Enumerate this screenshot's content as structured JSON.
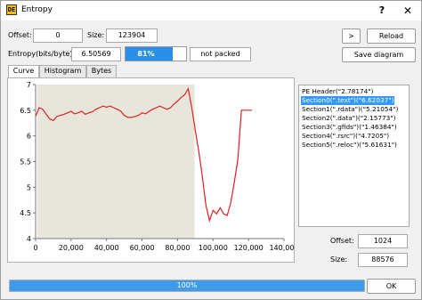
{
  "window": {
    "title": "Entropy",
    "icon": "app-logo-icon",
    "help_label": "?",
    "close_label": "✕"
  },
  "info": {
    "offset_label": "Offset:",
    "offset_value": "0",
    "size_label": "Size:",
    "size_value": "123904",
    "entropy_label": "Entropy(bits/byte):",
    "entropy_value": "6.50569",
    "entropy_percent_text": "81%",
    "entropy_fraction": 0.81,
    "packed_status": "not packed"
  },
  "buttons": {
    "toggle": ">",
    "reload": "Reload",
    "save": "Save diagram",
    "ok": "OK"
  },
  "tabs": [
    {
      "label": "Curve"
    },
    {
      "label": "Histogram"
    },
    {
      "label": "Bytes"
    }
  ],
  "sections": {
    "items": [
      "PE Header(\"2.78174\")",
      "Section0(\".text\")(\"6.62037\")",
      "Section1(\".rdata\")(\"5.21054\")",
      "Section2(\".data\")(\"2.15773\")",
      "Section3(\".gfids\")(\"1.46384\")",
      "Section4(\".rsrc\")(\"4.7205\")",
      "Section5(\".reloc\")(\"5.61631\")"
    ],
    "selected_index": 1
  },
  "selection": {
    "offset_label": "Offset:",
    "offset_value": "1024",
    "size_label": "Size:",
    "size_value": "88576"
  },
  "progress": {
    "text": "100%",
    "fraction": 1.0
  },
  "colors": {
    "curve": "#e02020",
    "highlight": "#e8e6da",
    "accent": "#3399ff",
    "entropy_fill": "#2a8fe8"
  },
  "chart_data": {
    "type": "line",
    "xlim": [
      0,
      140000
    ],
    "ylim": [
      4,
      7
    ],
    "x_ticks": [
      "0",
      "20,000",
      "40,000",
      "60,000",
      "80,000",
      "100,000",
      "120,000",
      "140,000"
    ],
    "y_ticks": [
      "4",
      "4.5",
      "5",
      "5.5",
      "6",
      "6.5",
      "7"
    ],
    "highlight_range": [
      1024,
      89600
    ],
    "series": [
      {
        "x": [
          0,
          2000,
          4000,
          6000,
          8000,
          10000,
          12000,
          14000,
          16000,
          18000,
          20000,
          22000,
          24000,
          26000,
          28000,
          30000,
          32000,
          34000,
          36000,
          38000,
          40000,
          42000,
          44000,
          46000,
          48000,
          50000,
          52000,
          54000,
          56000,
          58000,
          60000,
          62000,
          64000,
          66000,
          68000,
          70000,
          72000,
          74000,
          76000,
          78000,
          80000,
          82000,
          84000,
          86000,
          88000,
          90000,
          92000,
          94000,
          96000,
          98000,
          100000,
          102000,
          104000,
          106000,
          108000,
          110000,
          112000,
          114000,
          116000,
          118000,
          120000,
          122000
        ],
        "y": [
          6.38,
          6.55,
          6.52,
          6.42,
          6.33,
          6.3,
          6.38,
          6.4,
          6.42,
          6.45,
          6.48,
          6.43,
          6.45,
          6.48,
          6.42,
          6.45,
          6.47,
          6.52,
          6.55,
          6.58,
          6.56,
          6.58,
          6.55,
          6.52,
          6.48,
          6.4,
          6.36,
          6.36,
          6.38,
          6.4,
          6.45,
          6.43,
          6.48,
          6.52,
          6.55,
          6.58,
          6.55,
          6.52,
          6.55,
          6.62,
          6.68,
          6.75,
          6.8,
          6.92,
          6.55,
          6.1,
          5.7,
          5.2,
          4.65,
          4.35,
          4.55,
          4.48,
          4.6,
          4.48,
          4.45,
          4.7,
          5.1,
          5.55,
          6.5,
          6.5,
          6.5,
          6.5
        ]
      }
    ]
  }
}
